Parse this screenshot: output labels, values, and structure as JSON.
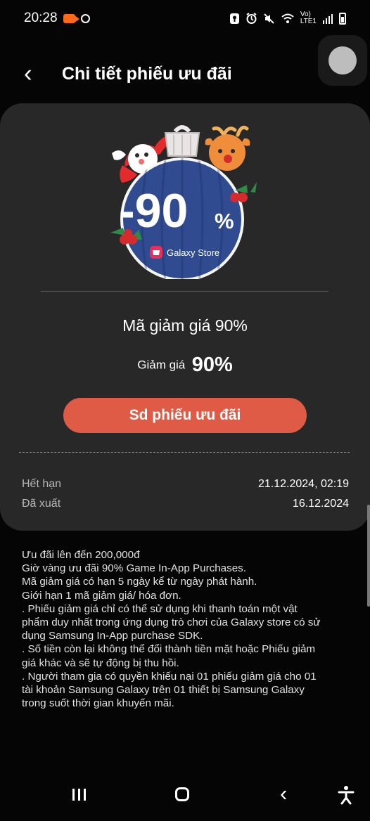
{
  "status_bar": {
    "time": "20:28",
    "volte": "Vo)",
    "lte": "LTE1",
    "icons": [
      "screen-record-icon",
      "circle-icon",
      "key-icon",
      "alarm-icon",
      "mute-icon",
      "wifi-icon",
      "signal-icon",
      "battery-icon"
    ]
  },
  "header": {
    "title": "Chi tiết phiếu ưu đãi",
    "back_icon": "‹"
  },
  "promo": {
    "discount_text": "-90",
    "percent_sign": "%",
    "store_name": "Galaxy Store",
    "colors": {
      "ornament": "#304b8f",
      "ornament_border": "#f4f4f4",
      "store_badge": "#e72f5d"
    }
  },
  "coupon": {
    "name": "Mã giảm giá 90%",
    "discount_label": "Giảm giá",
    "discount_value": "90%",
    "button_label": "Sd phiếu ưu đãi",
    "expiry_label": "Hết hạn",
    "expiry_value": "21.12.2024, 02:19",
    "issued_label": "Đã xuất",
    "issued_value": "16.12.2024"
  },
  "terms": [
    "Ưu đãi lên đến 200,000đ",
    "Giờ vàng ưu đãi 90% Game In-App Purchases.",
    "Mã giảm giá có hạn 5 ngày kể từ ngày phát hành.",
    "Giới hạn 1 mã giảm giá/ hóa đơn.",
    ". Phiếu giảm giá chỉ có thể sử dụng khi thanh toán một vật",
    "phẩm duy nhất trong ứng dụng trò chơi của Galaxy store có sử",
    "dụng Samsung In-App purchase SDK.",
    ". Số tiền còn lại không thể đổi thành tiền mặt hoặc Phiếu giảm",
    "giá khác và sẽ tự động bị thu hồi.",
    ". Người tham gia có quyền khiếu nại 01 phiếu giảm giá cho 01",
    "tài khoản Samsung Galaxy trên 01 thiết bị Samsung Galaxy",
    "trong suốt thời gian khuyến mãi."
  ],
  "navigation": {
    "back_icon": "‹",
    "icons": [
      "recent-apps-icon",
      "home-icon",
      "back-icon",
      "accessibility-icon"
    ]
  },
  "colors": {
    "background": "#050505",
    "card": "#282828",
    "accent": "#df5b45",
    "text": "#ffffff",
    "secondary_text": "#b8b8b8"
  }
}
